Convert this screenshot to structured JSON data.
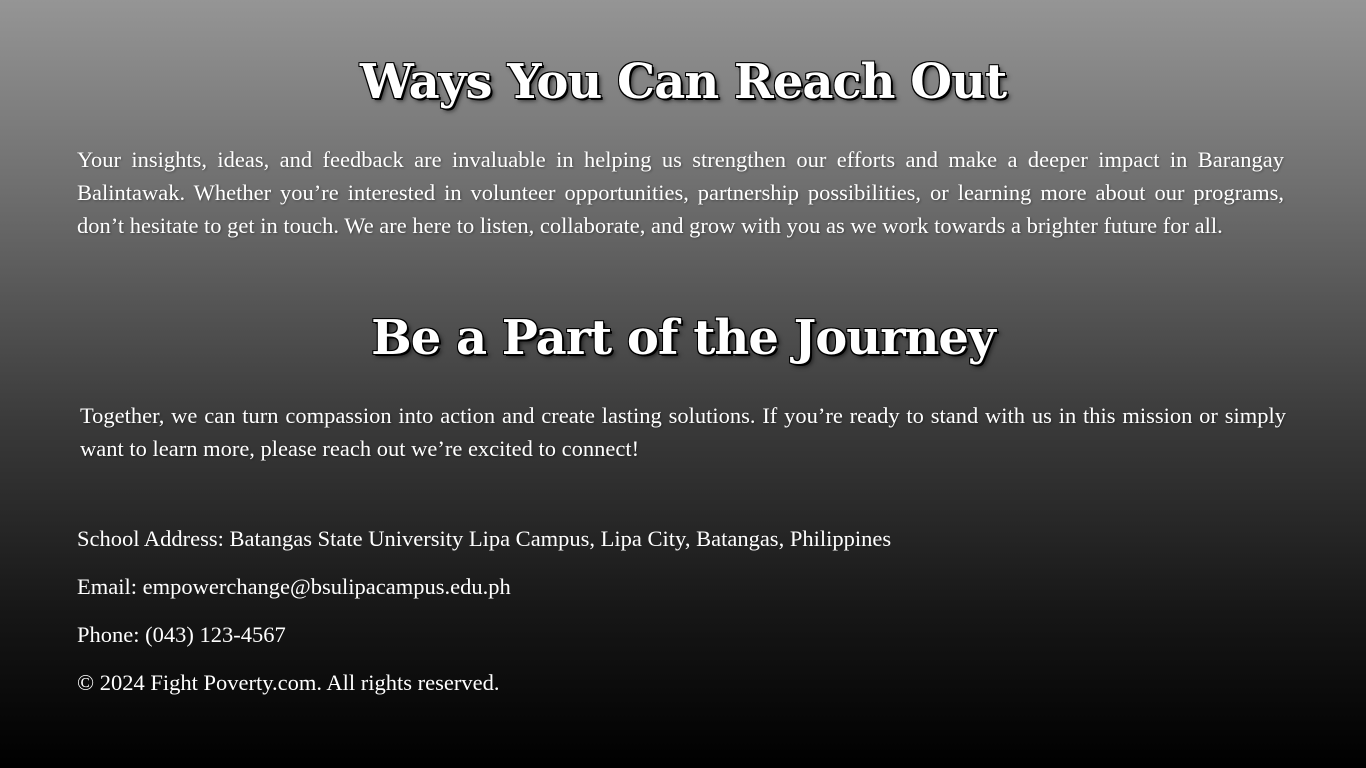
{
  "section1": {
    "heading": "Ways You Can Reach Out",
    "body": "Your insights, ideas, and feedback are invaluable in helping us strengthen our efforts and make a deeper impact in Barangay Balintawak. Whether you’re interested in volunteer opportunities, partnership possibilities, or learning more about our programs, don’t hesitate to get in touch. We are here to listen, collaborate, and grow with you as we work towards a brighter future for all."
  },
  "section2": {
    "heading": "Be a Part of the Journey",
    "body": "Together, we can turn compassion into action and create lasting solutions. If you’re ready to stand with us in this mission or simply want to learn more, please reach out we’re excited to connect!"
  },
  "contact": {
    "address": "School Address: Batangas State University Lipa Campus, Lipa City, Batangas, Philippines",
    "email": "Email: empowerchange@bsulipacampus.edu.ph",
    "phone": "Phone: (043) 123-4567"
  },
  "footer": {
    "copyright": "© 2024 Fight Poverty.com. All rights reserved."
  },
  "colors": {
    "background_top": "#959595",
    "background_bottom": "#000000",
    "text": "#ffffff"
  }
}
